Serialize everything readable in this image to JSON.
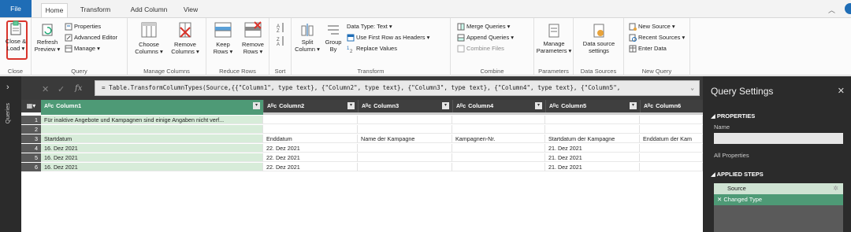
{
  "tabs": [
    {
      "label": "File"
    },
    {
      "label": "Home"
    },
    {
      "label": "Transform"
    },
    {
      "label": "Add Column"
    },
    {
      "label": "View"
    }
  ],
  "ribbon": {
    "close": {
      "btn": "Close &",
      "btn2": "Load ▾",
      "group": "Close"
    },
    "query": {
      "refresh": "Refresh",
      "refresh2": "Preview ▾",
      "properties": "Properties",
      "advanced": "Advanced Editor",
      "manage": "Manage ▾",
      "group": "Query"
    },
    "columns": {
      "choose": "Choose",
      "choose2": "Columns ▾",
      "remove": "Remove",
      "remove2": "Columns ▾",
      "group": "Manage Columns"
    },
    "rows": {
      "keep": "Keep",
      "keep2": "Rows ▾",
      "remove": "Remove",
      "remove2": "Rows ▾",
      "group": "Reduce Rows"
    },
    "sort": {
      "group": "Sort"
    },
    "transform": {
      "split": "Split",
      "split2": "Column ▾",
      "groupby": "Group",
      "groupby2": "By",
      "datatype": "Data Type: Text ▾",
      "firstrow": "Use First Row as Headers ▾",
      "replace": "Replace Values",
      "group": "Transform"
    },
    "combine": {
      "merge": "Merge Queries ▾",
      "append": "Append Queries ▾",
      "files": "Combine Files",
      "group": "Combine"
    },
    "parameters": {
      "manage": "Manage",
      "manage2": "Parameters ▾",
      "group": "Parameters"
    },
    "datasources": {
      "btn": "Data source",
      "btn2": "settings",
      "group": "Data Sources"
    },
    "newquery": {
      "newsource": "New Source ▾",
      "recent": "Recent Sources ▾",
      "enter": "Enter Data",
      "group": "New Query"
    }
  },
  "sidebar": {
    "label": "Queries",
    "arrow": "›"
  },
  "formula": {
    "x": "✕",
    "check": "✓",
    "fx": "fx",
    "text": "= Table.TransformColumnTypes(Source,{{\"Column1\", type text}, {\"Column2\", type text}, {\"Column3\", type text}, {\"Column4\", type text}, {\"Column5\",",
    "dropdown": "⌄"
  },
  "grid": {
    "table_icon": "▦▾",
    "type_abbr": "Aᴮc",
    "columns": [
      "Column1",
      "Column2",
      "Column3",
      "Column4",
      "Column5",
      "Column6"
    ],
    "rows": [
      {
        "n": "1",
        "cells": [
          "Für inaktive Angebote und Kampagnen sind einige Angaben nicht verf...",
          "",
          "",
          "",
          "",
          ""
        ]
      },
      {
        "n": "2",
        "cells": [
          "",
          "",
          "",
          "",
          "",
          ""
        ]
      },
      {
        "n": "3",
        "cells": [
          "Startdatum",
          "Enddatum",
          "Name der Kampagne",
          "Kampagnen-Nr.",
          "Startdatum der Kampagne",
          "Enddatum der Kam"
        ]
      },
      {
        "n": "4",
        "cells": [
          "16. Dez 2021",
          "22. Dez 2021",
          "",
          "",
          "21. Dez 2021",
          ""
        ]
      },
      {
        "n": "5",
        "cells": [
          "16. Dez 2021",
          "22. Dez 2021",
          "",
          "",
          "21. Dez 2021",
          ""
        ]
      },
      {
        "n": "6",
        "cells": [
          "16. Dez 2021",
          "22. Dez 2021",
          "",
          "",
          "21. Dez 2021",
          ""
        ]
      }
    ]
  },
  "settings": {
    "title": "Query Settings",
    "close": "✕",
    "properties": "◢ PROPERTIES",
    "name_label": "Name",
    "all_props": "All Properties",
    "applied": "◢ APPLIED STEPS",
    "steps": [
      "Source",
      "Changed Type"
    ],
    "step_x": "✕",
    "gear": "✲"
  },
  "colors": {
    "accent": "#1f6db6",
    "green": "#4e9a76",
    "highlight": "#d9342b"
  }
}
